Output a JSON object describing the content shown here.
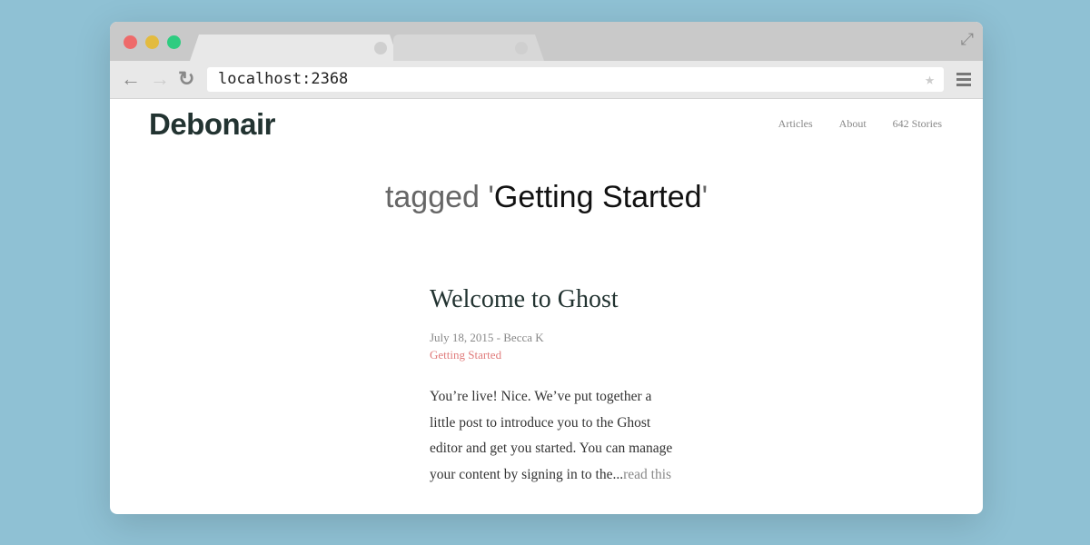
{
  "browser": {
    "url": "localhost:2368",
    "colors": {
      "close": "#ee6a6a",
      "minimize": "#e3bb3f",
      "maximize": "#2ecc80"
    }
  },
  "site": {
    "logo": "Debonair",
    "nav": [
      "Articles",
      "About",
      "642 Stories"
    ]
  },
  "heading": {
    "prefix": "tagged '",
    "tag": "Getting Started",
    "suffix": "'"
  },
  "post": {
    "title": "Welcome to Ghost",
    "meta": "July 18, 2015 - Becca K",
    "tag": "Getting Started",
    "excerpt": "You’re live! Nice. We’ve put together a little post to introduce you to the Ghost editor and get you started. You can manage your content by signing in to the...",
    "read_more": "read this"
  }
}
